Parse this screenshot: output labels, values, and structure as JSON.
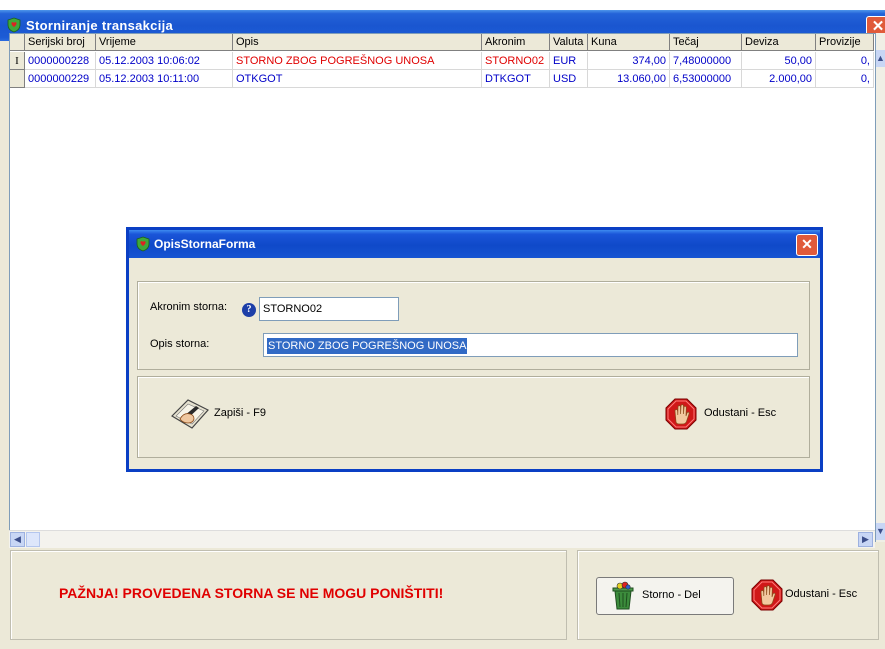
{
  "window": {
    "title": "Storniranje transakcija",
    "close_glyph": "✕"
  },
  "grid": {
    "columns": [
      "Serijski broj",
      "Vrijeme",
      "Opis",
      "Akronim",
      "Valuta",
      "Kuna",
      "Tečaj",
      "Deviza",
      "Provizije"
    ],
    "rows": [
      {
        "indicator": "I",
        "serijski_broj": "0000000228",
        "vrijeme": "05.12.2003 10:06:02",
        "opis": "STORNO ZBOG POGREŠNOG UNOSA",
        "akronim": "STORNO02",
        "valuta": "EUR",
        "kuna": "374,00",
        "tecaj": "7,48000000",
        "deviza": "50,00",
        "provizije": "0,"
      },
      {
        "indicator": "",
        "serijski_broj": "0000000229",
        "vrijeme": "05.12.2003 10:11:00",
        "opis": "OTKGOT",
        "akronim": "DTKGOT",
        "valuta": "USD",
        "kuna": "13.060,00",
        "tecaj": "6,53000000",
        "deviza": "2.000,00",
        "provizije": "0,"
      }
    ]
  },
  "bottom": {
    "warning": "PAŽNJA!  PROVEDENA STORNA SE NE MOGU PONIŠTITI!",
    "storno_label": "Storno - Del",
    "cancel_label": "Odustani - Esc"
  },
  "dialog": {
    "title": "OpisStornaForma",
    "close_glyph": "✕",
    "acronym_label": "Akronim storna:",
    "acronym_value": "STORNO02",
    "description_label": "Opis storna:",
    "description_value": "STORNO ZBOG POGREŠNOG UNOSA",
    "save_label": "Zapiši - F9",
    "cancel_label": "Odustani - Esc"
  },
  "icons": {
    "title_icon": "shield-heart-icon",
    "help_icon": "question-icon",
    "save_icon": "hand-pen-icon",
    "stop_icon": "stop-hand-icon",
    "storno_icon": "trash-bin-icon"
  },
  "colors": {
    "accent_red": "#e00000",
    "text_blue": "#0000c8",
    "titlebar_blue": "#1a56d0"
  }
}
